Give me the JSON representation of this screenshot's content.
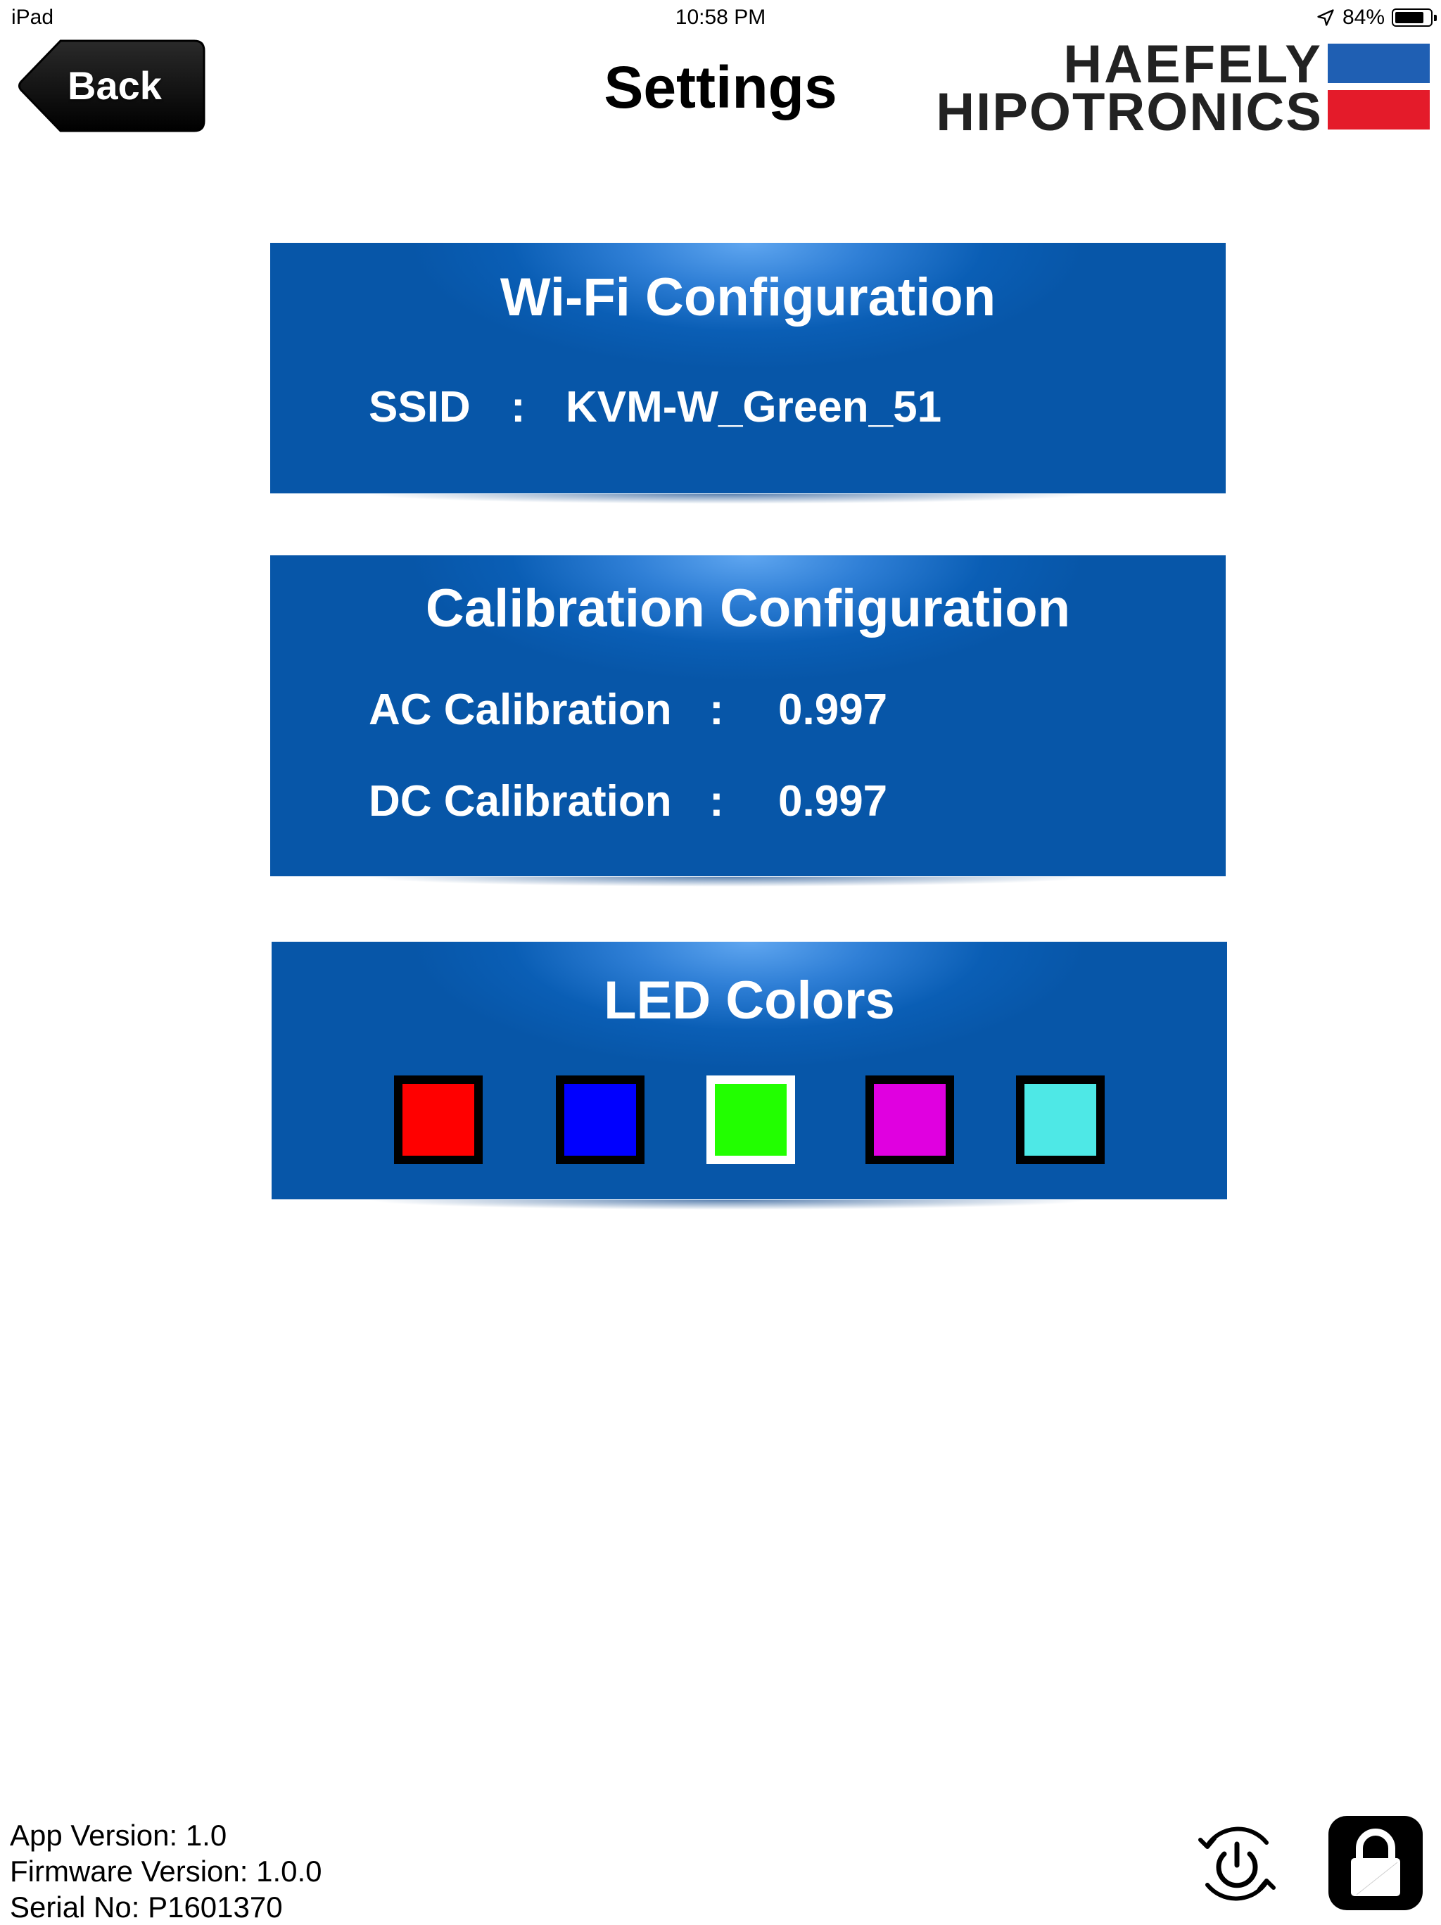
{
  "status_bar": {
    "device": "iPad",
    "time": "10:58 PM",
    "battery_percent": "84%",
    "battery_level": 0.84,
    "icons": [
      "location-arrow-icon",
      "battery-icon"
    ]
  },
  "header": {
    "back_label": "Back",
    "title": "Settings",
    "logo_line1": "HAEFELY",
    "logo_line2": "HIPOTRONICS",
    "logo_colors": {
      "blue": "#1f5fb3",
      "red": "#e41b2a"
    }
  },
  "wifi": {
    "title": "Wi-Fi Configuration",
    "ssid_label": "SSID",
    "separator": ":",
    "ssid_value": "KVM-W_Green_51"
  },
  "calibration": {
    "title": "Calibration Configuration",
    "separator": ":",
    "ac_label": "AC Calibration",
    "ac_value": "0.997",
    "dc_label": "DC Calibration",
    "dc_value": "0.997"
  },
  "led": {
    "title": "LED Colors",
    "selected_index": 2,
    "colors": [
      "#ff0000",
      "#0000ff",
      "#22ff00",
      "#e000e0",
      "#4ee8e6"
    ]
  },
  "footer": {
    "app_version": "App Version: 1.0",
    "firmware_version": "Firmware Version: 1.0.0",
    "serial_no": "Serial No: P1601370",
    "icons": [
      "power-refresh-icon",
      "lock-icon"
    ]
  },
  "theme": {
    "panel_blue": "#0756a8",
    "panel_highlight": "#5fa6f0"
  }
}
